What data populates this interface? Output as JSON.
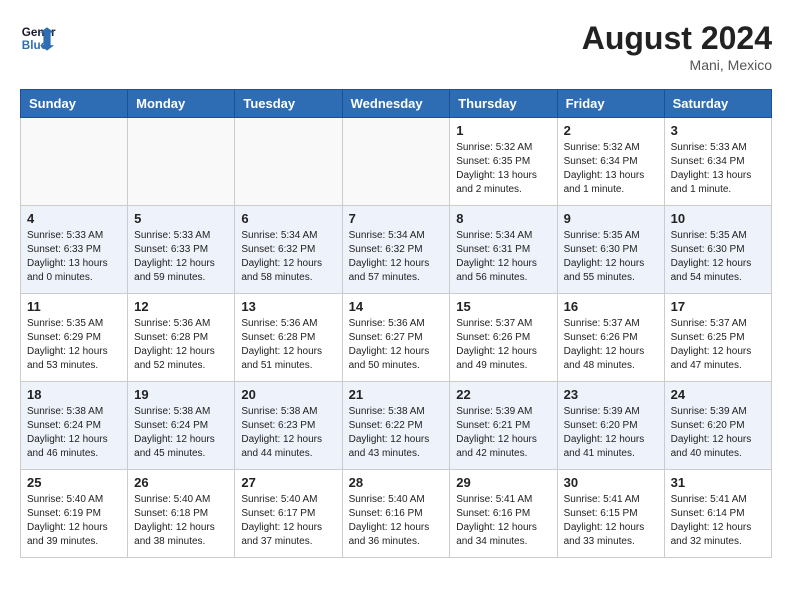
{
  "header": {
    "logo_line1": "General",
    "logo_line2": "Blue",
    "month_year": "August 2024",
    "location": "Mani, Mexico"
  },
  "weekdays": [
    "Sunday",
    "Monday",
    "Tuesday",
    "Wednesday",
    "Thursday",
    "Friday",
    "Saturday"
  ],
  "weeks": [
    [
      {
        "day": "",
        "info": ""
      },
      {
        "day": "",
        "info": ""
      },
      {
        "day": "",
        "info": ""
      },
      {
        "day": "",
        "info": ""
      },
      {
        "day": "1",
        "info": "Sunrise: 5:32 AM\nSunset: 6:35 PM\nDaylight: 13 hours\nand 2 minutes."
      },
      {
        "day": "2",
        "info": "Sunrise: 5:32 AM\nSunset: 6:34 PM\nDaylight: 13 hours\nand 1 minute."
      },
      {
        "day": "3",
        "info": "Sunrise: 5:33 AM\nSunset: 6:34 PM\nDaylight: 13 hours\nand 1 minute."
      }
    ],
    [
      {
        "day": "4",
        "info": "Sunrise: 5:33 AM\nSunset: 6:33 PM\nDaylight: 13 hours\nand 0 minutes."
      },
      {
        "day": "5",
        "info": "Sunrise: 5:33 AM\nSunset: 6:33 PM\nDaylight: 12 hours\nand 59 minutes."
      },
      {
        "day": "6",
        "info": "Sunrise: 5:34 AM\nSunset: 6:32 PM\nDaylight: 12 hours\nand 58 minutes."
      },
      {
        "day": "7",
        "info": "Sunrise: 5:34 AM\nSunset: 6:32 PM\nDaylight: 12 hours\nand 57 minutes."
      },
      {
        "day": "8",
        "info": "Sunrise: 5:34 AM\nSunset: 6:31 PM\nDaylight: 12 hours\nand 56 minutes."
      },
      {
        "day": "9",
        "info": "Sunrise: 5:35 AM\nSunset: 6:30 PM\nDaylight: 12 hours\nand 55 minutes."
      },
      {
        "day": "10",
        "info": "Sunrise: 5:35 AM\nSunset: 6:30 PM\nDaylight: 12 hours\nand 54 minutes."
      }
    ],
    [
      {
        "day": "11",
        "info": "Sunrise: 5:35 AM\nSunset: 6:29 PM\nDaylight: 12 hours\nand 53 minutes."
      },
      {
        "day": "12",
        "info": "Sunrise: 5:36 AM\nSunset: 6:28 PM\nDaylight: 12 hours\nand 52 minutes."
      },
      {
        "day": "13",
        "info": "Sunrise: 5:36 AM\nSunset: 6:28 PM\nDaylight: 12 hours\nand 51 minutes."
      },
      {
        "day": "14",
        "info": "Sunrise: 5:36 AM\nSunset: 6:27 PM\nDaylight: 12 hours\nand 50 minutes."
      },
      {
        "day": "15",
        "info": "Sunrise: 5:37 AM\nSunset: 6:26 PM\nDaylight: 12 hours\nand 49 minutes."
      },
      {
        "day": "16",
        "info": "Sunrise: 5:37 AM\nSunset: 6:26 PM\nDaylight: 12 hours\nand 48 minutes."
      },
      {
        "day": "17",
        "info": "Sunrise: 5:37 AM\nSunset: 6:25 PM\nDaylight: 12 hours\nand 47 minutes."
      }
    ],
    [
      {
        "day": "18",
        "info": "Sunrise: 5:38 AM\nSunset: 6:24 PM\nDaylight: 12 hours\nand 46 minutes."
      },
      {
        "day": "19",
        "info": "Sunrise: 5:38 AM\nSunset: 6:24 PM\nDaylight: 12 hours\nand 45 minutes."
      },
      {
        "day": "20",
        "info": "Sunrise: 5:38 AM\nSunset: 6:23 PM\nDaylight: 12 hours\nand 44 minutes."
      },
      {
        "day": "21",
        "info": "Sunrise: 5:38 AM\nSunset: 6:22 PM\nDaylight: 12 hours\nand 43 minutes."
      },
      {
        "day": "22",
        "info": "Sunrise: 5:39 AM\nSunset: 6:21 PM\nDaylight: 12 hours\nand 42 minutes."
      },
      {
        "day": "23",
        "info": "Sunrise: 5:39 AM\nSunset: 6:20 PM\nDaylight: 12 hours\nand 41 minutes."
      },
      {
        "day": "24",
        "info": "Sunrise: 5:39 AM\nSunset: 6:20 PM\nDaylight: 12 hours\nand 40 minutes."
      }
    ],
    [
      {
        "day": "25",
        "info": "Sunrise: 5:40 AM\nSunset: 6:19 PM\nDaylight: 12 hours\nand 39 minutes."
      },
      {
        "day": "26",
        "info": "Sunrise: 5:40 AM\nSunset: 6:18 PM\nDaylight: 12 hours\nand 38 minutes."
      },
      {
        "day": "27",
        "info": "Sunrise: 5:40 AM\nSunset: 6:17 PM\nDaylight: 12 hours\nand 37 minutes."
      },
      {
        "day": "28",
        "info": "Sunrise: 5:40 AM\nSunset: 6:16 PM\nDaylight: 12 hours\nand 36 minutes."
      },
      {
        "day": "29",
        "info": "Sunrise: 5:41 AM\nSunset: 6:16 PM\nDaylight: 12 hours\nand 34 minutes."
      },
      {
        "day": "30",
        "info": "Sunrise: 5:41 AM\nSunset: 6:15 PM\nDaylight: 12 hours\nand 33 minutes."
      },
      {
        "day": "31",
        "info": "Sunrise: 5:41 AM\nSunset: 6:14 PM\nDaylight: 12 hours\nand 32 minutes."
      }
    ]
  ]
}
